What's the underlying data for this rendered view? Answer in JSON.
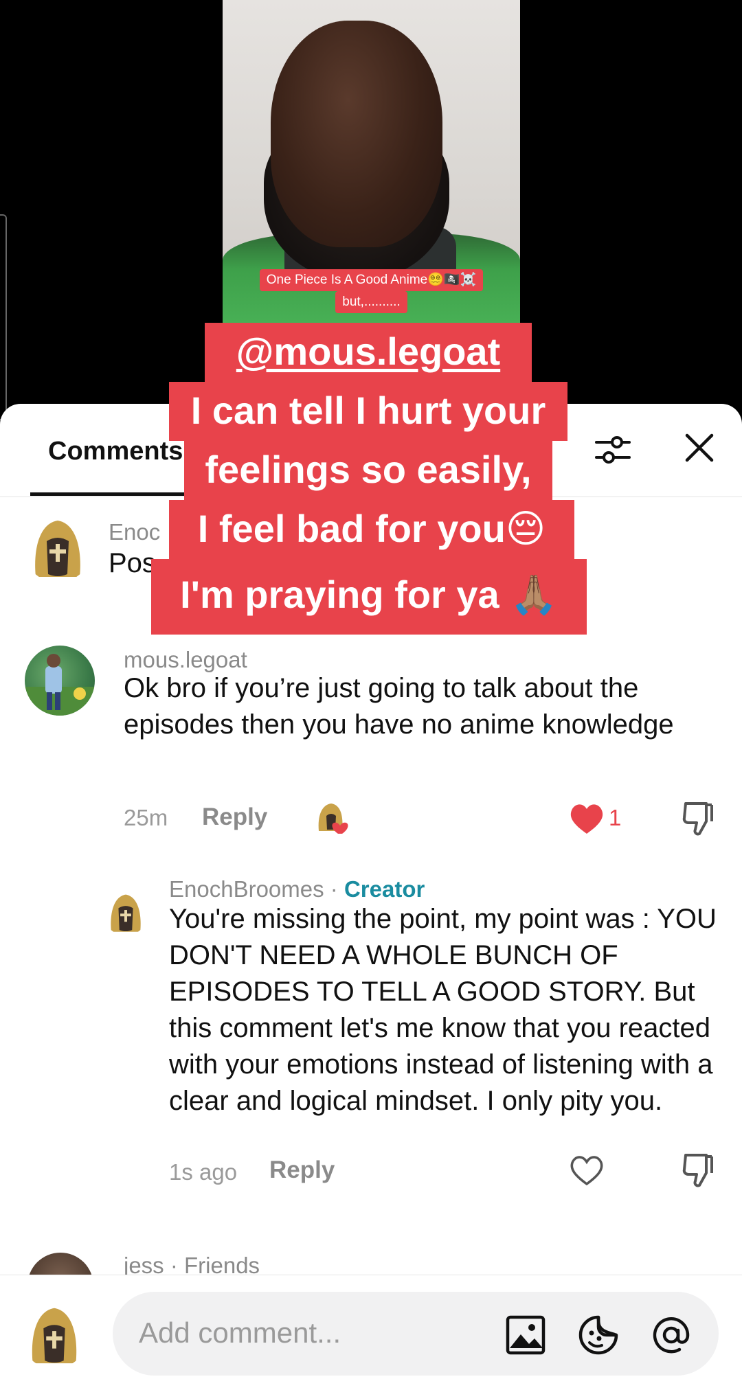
{
  "video": {
    "caption_line1": "One Piece Is A Good Anime😵‍💫🏴‍☠️☠️",
    "caption_line2": "but,.........."
  },
  "overlay": {
    "mention": "@mous.legoat",
    "line2": "I can tell I hurt your",
    "line3": "feelings so easily,",
    "line4": "I feel bad for you😔",
    "line5": "I'm praying for ya 🙏🏽"
  },
  "sheet": {
    "tab_label": "Comments",
    "icons": {
      "filter": "filter-sliders-icon",
      "close": "close-icon"
    }
  },
  "comments": [
    {
      "username_partial": "Enoc",
      "text_partial": "Pos"
    },
    {
      "username": "mous.legoat",
      "text": "Ok bro if you’re just going to talk about the episodes then you have no anime knowledge",
      "time": "25m",
      "reply_label": "Reply",
      "like_count": "1",
      "liked": true
    },
    {
      "username": "EnochBroomes",
      "separator": " · ",
      "badge": "Creator",
      "text": "You're missing the point, my point was : YOU DON'T NEED A WHOLE BUNCH OF EPISODES TO TELL A GOOD STORY. But this comment let's me know that you reacted with your emotions instead of listening with a clear and logical mindset. I only pity you.",
      "time": "1s ago",
      "reply_label": "Reply"
    },
    {
      "username": "jess · Friends"
    }
  ],
  "input": {
    "placeholder": "Add comment...",
    "icons": [
      "image-icon",
      "emoji-icon",
      "mention-icon"
    ]
  },
  "colors": {
    "accent_red": "#e8434b",
    "creator_teal": "#1a8ca0"
  }
}
